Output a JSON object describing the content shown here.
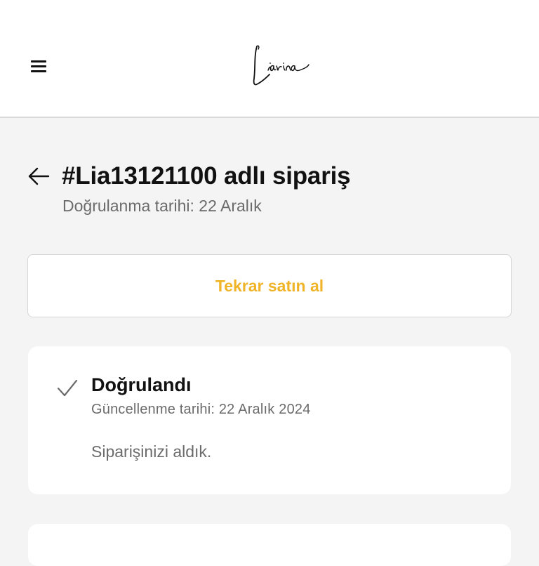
{
  "header": {
    "logo_text": "Liarina",
    "menu_icon": "hamburger-menu-icon"
  },
  "order": {
    "title": "#Lia13121100 adlı sipariş",
    "confirmed_date": "Doğrulanma tarihi: 22 Aralık",
    "back_icon": "arrow-left-icon"
  },
  "actions": {
    "rebuy_label": "Tekrar satın al",
    "accent_color": "#f0b429"
  },
  "status": {
    "icon": "checkmark-icon",
    "title": "Doğrulandı",
    "updated": "Güncellenme tarihi: 22 Aralık 2024",
    "message": "Siparişinizi aldık."
  }
}
